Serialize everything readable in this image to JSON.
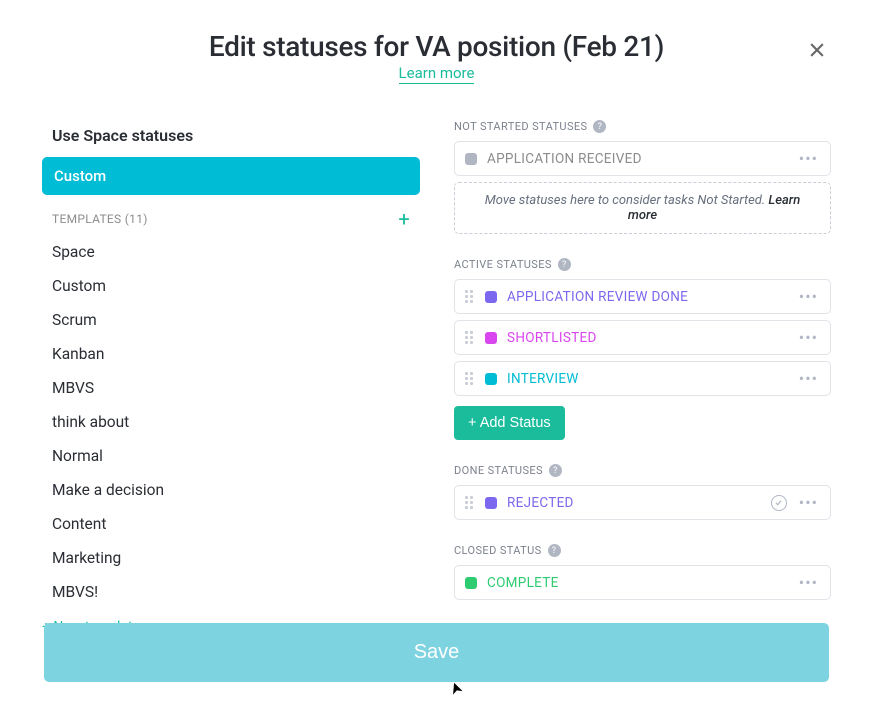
{
  "header": {
    "title": "Edit statuses for VA position (Feb 21)",
    "learn_more": "Learn more"
  },
  "sidebar": {
    "use_space": "Use Space statuses",
    "custom_selected": "Custom",
    "templates_label": "TEMPLATES (11)",
    "templates": [
      "Space",
      "Custom",
      "Scrum",
      "Kanban",
      "MBVS",
      "think about",
      "Normal",
      "Make a decision",
      "Content",
      "Marketing",
      "MBVS!"
    ],
    "new_template": "+ New template"
  },
  "sections": {
    "not_started_label": "NOT STARTED STATUSES",
    "active_label": "ACTIVE STATUSES",
    "done_label": "DONE STATUSES",
    "closed_label": "CLOSED STATUS",
    "dropzone_text": "Move statuses here to consider tasks Not Started. ",
    "dropzone_learn": "Learn more",
    "add_status": "+ Add Status"
  },
  "statuses": {
    "not_started": [
      {
        "name": "APPLICATION RECEIVED",
        "color": "#b0b7c3",
        "text_color": "#8c8c8c"
      }
    ],
    "active": [
      {
        "name": "APPLICATION REVIEW DONE",
        "color": "#7b68ee",
        "text_color": "#7b68ee"
      },
      {
        "name": "SHORTLISTED",
        "color": "#d946ef",
        "text_color": "#d946ef"
      },
      {
        "name": "INTERVIEW",
        "color": "#00bcd4",
        "text_color": "#00bcd4"
      }
    ],
    "done": [
      {
        "name": "REJECTED",
        "color": "#7b68ee",
        "text_color": "#7b68ee"
      }
    ],
    "closed": [
      {
        "name": "COMPLETE",
        "color": "#2ecc71",
        "text_color": "#2ecc71"
      }
    ]
  },
  "footer": {
    "save": "Save"
  }
}
